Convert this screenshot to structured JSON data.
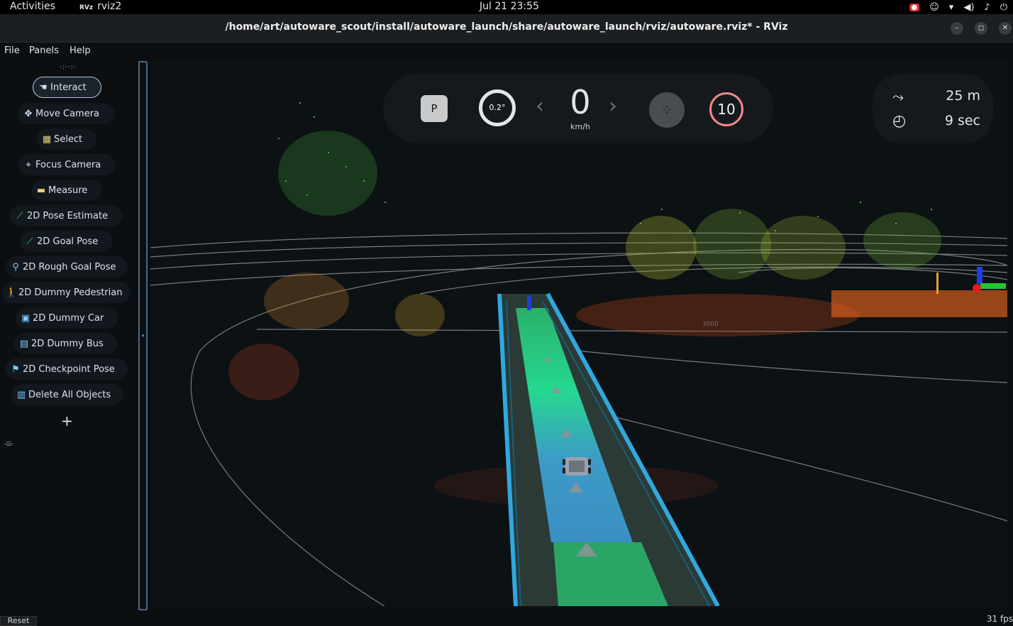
{
  "topbar": {
    "activities": "Activities",
    "app_badge": "RVz",
    "app_name": "rviz2",
    "clock": "Jul 21  23:55"
  },
  "window": {
    "title": "/home/art/autoware_scout/install/autoware_launch/share/autoware_launch/rviz/autoware.rviz* - RViz"
  },
  "menu": [
    "File",
    "Panels",
    "Help"
  ],
  "tools": [
    {
      "label": "Interact",
      "icon": "hand-icon",
      "active": true
    },
    {
      "label": "Move Camera",
      "icon": "move-icon"
    },
    {
      "label": "Select",
      "icon": "select-icon"
    },
    {
      "label": "Focus Camera",
      "icon": "focus-icon"
    },
    {
      "label": "Measure",
      "icon": "ruler-icon"
    },
    {
      "label": "2D Pose Estimate",
      "icon": "arrow-icon"
    },
    {
      "label": "2D Goal Pose",
      "icon": "arrow-icon"
    },
    {
      "label": "2D Rough Goal Pose",
      "icon": "pin-icon"
    },
    {
      "label": "2D Dummy Pedestrian",
      "icon": "pedestrian-icon"
    },
    {
      "label": "2D Dummy Car",
      "icon": "car-icon"
    },
    {
      "label": "2D Dummy Bus",
      "icon": "bus-icon"
    },
    {
      "label": "2D Checkpoint Pose",
      "icon": "flag-icon"
    },
    {
      "label": "Delete All Objects",
      "icon": "trash-icon"
    }
  ],
  "hud": {
    "gear": "P",
    "steering": "0.2°",
    "speed": "0",
    "speed_unit": "km/h",
    "speed_limit": "10"
  },
  "route": {
    "distance": "25 m",
    "time": "9 sec"
  },
  "viewport": {
    "ring_label": "3000"
  },
  "statusbar": {
    "reset": "Reset",
    "fps": "31 fps"
  },
  "colors": {
    "background": "#0c1114",
    "lane_green": "#21c77a",
    "lane_blue": "#3b8fc8",
    "lane_border": "#2fa8e0",
    "hud_bg": "#15191c"
  }
}
